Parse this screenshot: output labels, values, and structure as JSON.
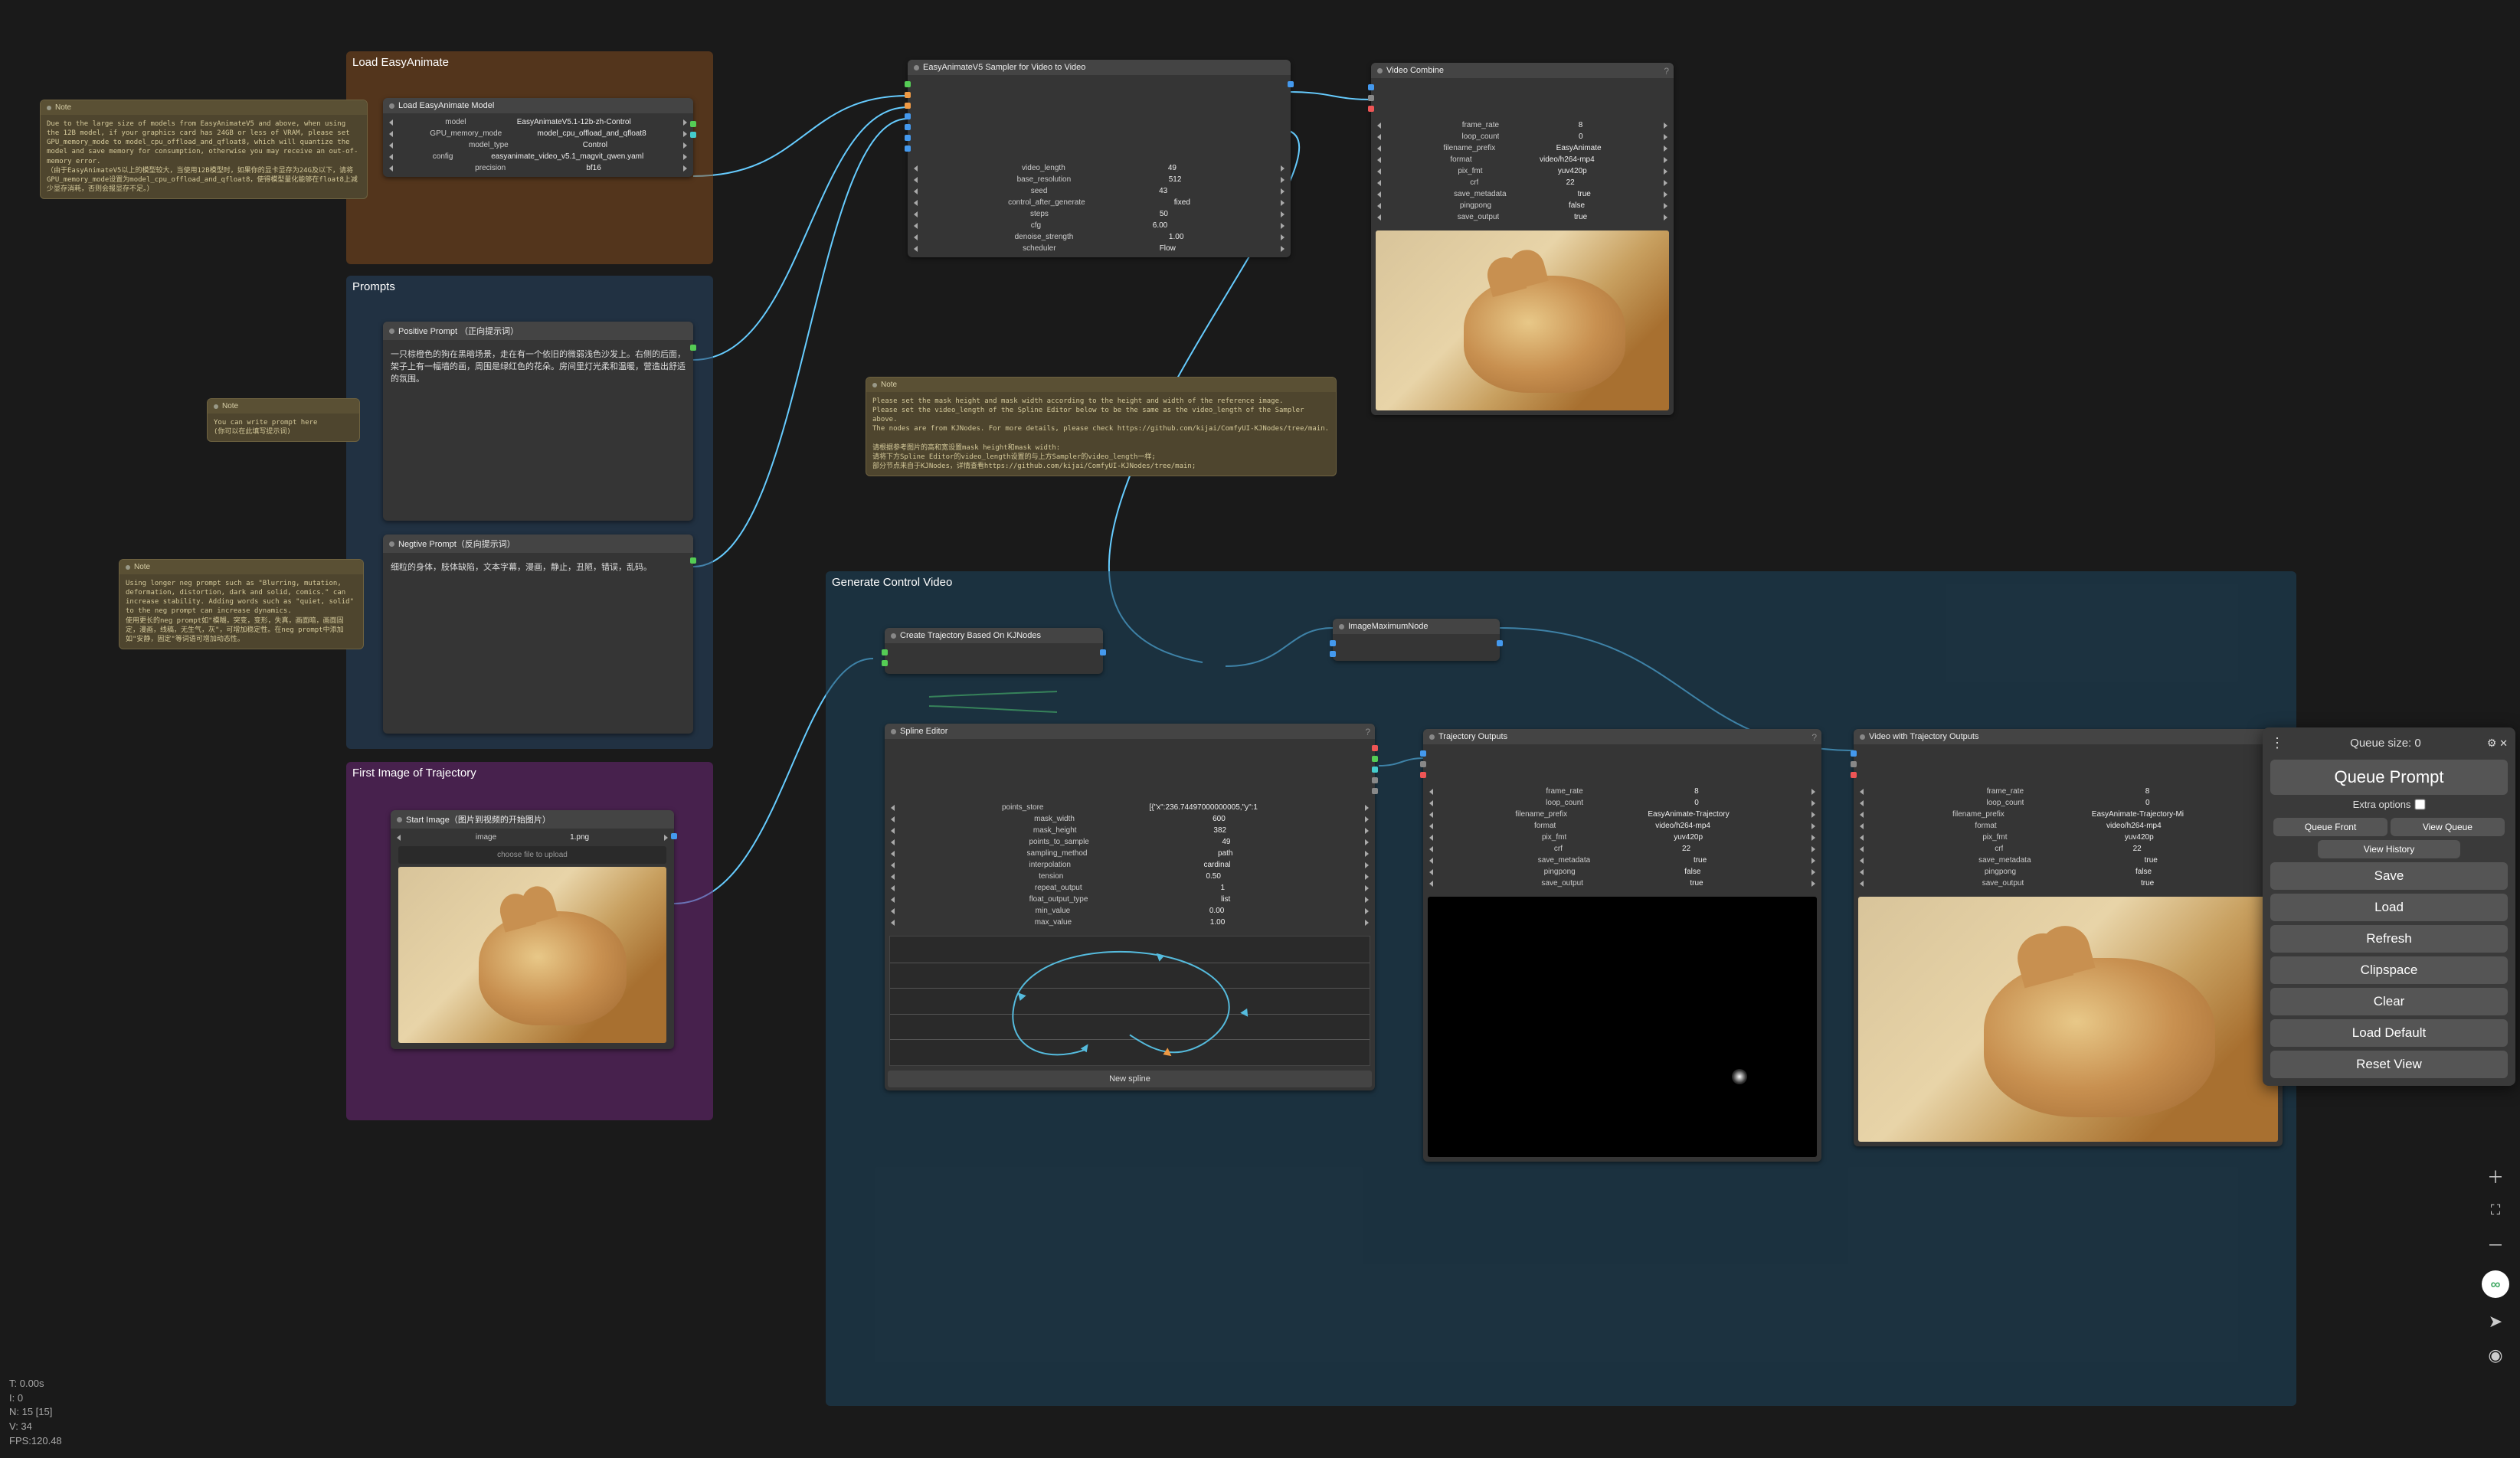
{
  "groups": {
    "loadEA": "Load EasyAnimate",
    "prompts": "Prompts",
    "firstImg": "First Image of Trajectory",
    "genCtrl": "Generate Control Video"
  },
  "notes": {
    "n1_title": "Note",
    "n1_body": "Due to the large size of models from EasyAnimateV5 and above, when using the 12B model, if your graphics card has 24GB or less of VRAM, please set GPU_memory_mode to model_cpu_offload_and_qfloat8, which will quantize the model and save memory for consumption, otherwise you may receive an out-of-memory error.\n（由于EasyAnimateV5以上的模型较大，当使用12B模型时，如果你的显卡显存为24G及以下，请将GPU_memory_mode设置为model_cpu_offload_and_qfloat8，使得模型量化能够在float8上减少显存消耗，否则会报显存不足。）",
    "n2_title": "Note",
    "n2_body": "You can write prompt here\n(你可以在此填写提示词)",
    "n3_title": "Note",
    "n3_body": "Using longer neg prompt such as \"Blurring, mutation, deformation, distortion, dark and solid, comics.\" can increase stability. Adding words such as \"quiet, solid\" to the neg prompt can increase dynamics.\n使用更长的neg prompt如\"模糊，突变，变形，失真，画面暗，画面固定，漫画，线稿，无生气，灰\"，可增加稳定性。在neg prompt中添加如\"安静，固定\"等词语可增加动态性。",
    "n4_title": "Note",
    "n4_body": "Please set the mask height and mask width according to the height and width of the reference image.\nPlease set the video_length of the Spline Editor below to be the same as the video_length of the Sampler above.\nThe nodes are from KJNodes. For more details, please check https://github.com/kijai/ComfyUI-KJNodes/tree/main.\n\n请根据参考图片的高和宽设置mask height和mask width:\n请将下方Spline Editor的video_length设置的与上方Sampler的video_length一样;\n部分节点来自于KJNodes，详情查看https://github.com/kijai/ComfyUI-KJNodes/tree/main;"
  },
  "loadModel": {
    "title": "Load EasyAnimate Model",
    "rows": [
      {
        "l": "model",
        "v": "EasyAnimateV5.1-12b-zh-Control"
      },
      {
        "l": "GPU_memory_mode",
        "v": "model_cpu_offload_and_qfloat8"
      },
      {
        "l": "model_type",
        "v": "Control"
      },
      {
        "l": "config",
        "v": "easyanimate_video_v5.1_magvit_qwen.yaml"
      },
      {
        "l": "precision",
        "v": "bf16"
      }
    ]
  },
  "posPrompt": {
    "title": "Positive Prompt （正向提示词）",
    "text": "一只棕橙色的狗在黑暗场景，走在有一个依旧的微弱浅色沙发上。右侧的后面，架子上有一幅墙的画，周围是绿红色的花朵。房间里灯光柔和温暖，营造出舒适的氛围。"
  },
  "negPrompt": {
    "title": "Negtive Prompt（反向提示词）",
    "text": "细粒的身体，肢体缺陷，文本字幕，漫画，静止，丑陋，错误，乱码。"
  },
  "startImage": {
    "title": "Start Image（图片到视频的开始图片）",
    "row_l": "image",
    "row_v": "1.png",
    "upload": "choose file to upload"
  },
  "sampler": {
    "title": "EasyAnimateV5 Sampler for Video to Video",
    "rows": [
      {
        "l": "video_length",
        "v": "49"
      },
      {
        "l": "base_resolution",
        "v": "512"
      },
      {
        "l": "seed",
        "v": "43"
      },
      {
        "l": "control_after_generate",
        "v": "fixed"
      },
      {
        "l": "steps",
        "v": "50"
      },
      {
        "l": "cfg",
        "v": "6.00"
      },
      {
        "l": "denoise_strength",
        "v": "1.00"
      },
      {
        "l": "scheduler",
        "v": "Flow"
      }
    ]
  },
  "videoCombine": {
    "title": "Video Combine",
    "rows": [
      {
        "l": "frame_rate",
        "v": "8"
      },
      {
        "l": "loop_count",
        "v": "0"
      },
      {
        "l": "filename_prefix",
        "v": "EasyAnimate"
      },
      {
        "l": "format",
        "v": "video/h264-mp4"
      },
      {
        "l": "pix_fmt",
        "v": "yuv420p"
      },
      {
        "l": "crf",
        "v": "22"
      },
      {
        "l": "save_metadata",
        "v": "true"
      },
      {
        "l": "pingpong",
        "v": "false"
      },
      {
        "l": "save_output",
        "v": "true"
      }
    ]
  },
  "createTraj": {
    "title": "Create Trajectory Based On KJNodes"
  },
  "imgMax": {
    "title": "ImageMaximumNode"
  },
  "splineEditor": {
    "title": "Spline Editor",
    "rows": [
      {
        "l": "points_store",
        "v": "[{\"x\":236.74497000000005,\"y\":1"
      },
      {
        "l": "mask_width",
        "v": "600"
      },
      {
        "l": "mask_height",
        "v": "382"
      },
      {
        "l": "points_to_sample",
        "v": "49"
      },
      {
        "l": "sampling_method",
        "v": "path"
      },
      {
        "l": "interpolation",
        "v": "cardinal"
      },
      {
        "l": "tension",
        "v": "0.50"
      },
      {
        "l": "repeat_output",
        "v": "1"
      },
      {
        "l": "float_output_type",
        "v": "list"
      },
      {
        "l": "min_value",
        "v": "0.00"
      },
      {
        "l": "max_value",
        "v": "1.00"
      }
    ],
    "new_spline": "New spline"
  },
  "trajOutputs": {
    "title": "Trajectory Outputs",
    "rows": [
      {
        "l": "frame_rate",
        "v": "8"
      },
      {
        "l": "loop_count",
        "v": "0"
      },
      {
        "l": "filename_prefix",
        "v": "EasyAnimate-Trajectory"
      },
      {
        "l": "format",
        "v": "video/h264-mp4"
      },
      {
        "l": "pix_fmt",
        "v": "yuv420p"
      },
      {
        "l": "crf",
        "v": "22"
      },
      {
        "l": "save_metadata",
        "v": "true"
      },
      {
        "l": "pingpong",
        "v": "false"
      },
      {
        "l": "save_output",
        "v": "true"
      }
    ]
  },
  "vidTrajOutputs": {
    "title": "Video with Trajectory Outputs",
    "rows": [
      {
        "l": "frame_rate",
        "v": "8"
      },
      {
        "l": "loop_count",
        "v": "0"
      },
      {
        "l": "filename_prefix",
        "v": "EasyAnimate-Trajectory-Mi"
      },
      {
        "l": "format",
        "v": "video/h264-mp4"
      },
      {
        "l": "pix_fmt",
        "v": "yuv420p"
      },
      {
        "l": "crf",
        "v": "22"
      },
      {
        "l": "save_metadata",
        "v": "true"
      },
      {
        "l": "pingpong",
        "v": "false"
      },
      {
        "l": "save_output",
        "v": "true"
      }
    ]
  },
  "panel": {
    "queue_size": "Queue size: 0",
    "queue_prompt": "Queue Prompt",
    "extra": "Extra options",
    "queue_front": "Queue Front",
    "view_queue": "View Queue",
    "view_history": "View History",
    "save": "Save",
    "load": "Load",
    "refresh": "Refresh",
    "clipspace": "Clipspace",
    "clear": "Clear",
    "load_default": "Load Default",
    "reset_view": "Reset View"
  },
  "stats": {
    "t": "T: 0.00s",
    "i": "I: 0",
    "n": "N: 15 [15]",
    "v": "V: 34",
    "fps": "FPS:120.48"
  }
}
